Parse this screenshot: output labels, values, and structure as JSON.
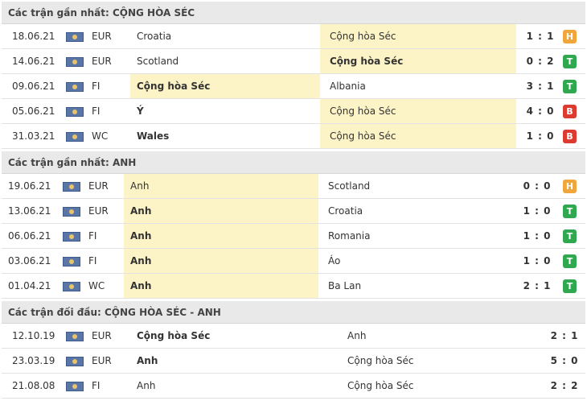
{
  "colors": {
    "H": "#f0a63a",
    "T": "#2fa84f",
    "B": "#dd3b30"
  },
  "sections": [
    {
      "title": "Các trận gần nhất: CỘNG HÒA SÉC",
      "rows": [
        {
          "date": "18.06.21",
          "comp": "EUR",
          "home": "Croatia",
          "away": "Cộng hòa Séc",
          "score": "1 : 1",
          "result": "H",
          "hl": "away",
          "bold": ""
        },
        {
          "date": "14.06.21",
          "comp": "EUR",
          "home": "Scotland",
          "away": "Cộng hòa Séc",
          "score": "0 : 2",
          "result": "T",
          "hl": "away",
          "bold": "away"
        },
        {
          "date": "09.06.21",
          "comp": "FI",
          "home": "Cộng hòa Séc",
          "away": "Albania",
          "score": "3 : 1",
          "result": "T",
          "hl": "home",
          "bold": "home"
        },
        {
          "date": "05.06.21",
          "comp": "FI",
          "home": "Ý",
          "away": "Cộng hòa Séc",
          "score": "4 : 0",
          "result": "B",
          "hl": "away",
          "bold": "home"
        },
        {
          "date": "31.03.21",
          "comp": "WC",
          "home": "Wales",
          "away": "Cộng hòa Séc",
          "score": "1 : 0",
          "result": "B",
          "hl": "away",
          "bold": "home"
        }
      ]
    },
    {
      "title": "Các trận gần nhất: ANH",
      "rows": [
        {
          "date": "19.06.21",
          "comp": "EUR",
          "home": "Anh",
          "away": "Scotland",
          "score": "0 : 0",
          "result": "H",
          "hl": "home",
          "bold": ""
        },
        {
          "date": "13.06.21",
          "comp": "EUR",
          "home": "Anh",
          "away": "Croatia",
          "score": "1 : 0",
          "result": "T",
          "hl": "home",
          "bold": "home"
        },
        {
          "date": "06.06.21",
          "comp": "FI",
          "home": "Anh",
          "away": "Romania",
          "score": "1 : 0",
          "result": "T",
          "hl": "home",
          "bold": "home"
        },
        {
          "date": "03.06.21",
          "comp": "FI",
          "home": "Anh",
          "away": "Áo",
          "score": "1 : 0",
          "result": "T",
          "hl": "home",
          "bold": "home"
        },
        {
          "date": "01.04.21",
          "comp": "WC",
          "home": "Anh",
          "away": "Ba Lan",
          "score": "2 : 1",
          "result": "T",
          "hl": "home",
          "bold": "home"
        }
      ]
    },
    {
      "title": "Các trận đối đầu: CỘNG HÒA SÉC - ANH",
      "rows": [
        {
          "date": "12.10.19",
          "comp": "EUR",
          "home": "Cộng hòa Séc",
          "away": "Anh",
          "score": "2 : 1",
          "result": "",
          "hl": "",
          "bold": "home"
        },
        {
          "date": "23.03.19",
          "comp": "EUR",
          "home": "Anh",
          "away": "Cộng hòa Séc",
          "score": "5 : 0",
          "result": "",
          "hl": "",
          "bold": "home"
        },
        {
          "date": "21.08.08",
          "comp": "FI",
          "home": "Anh",
          "away": "Cộng hòa Séc",
          "score": "2 : 2",
          "result": "",
          "hl": "",
          "bold": ""
        }
      ]
    }
  ]
}
